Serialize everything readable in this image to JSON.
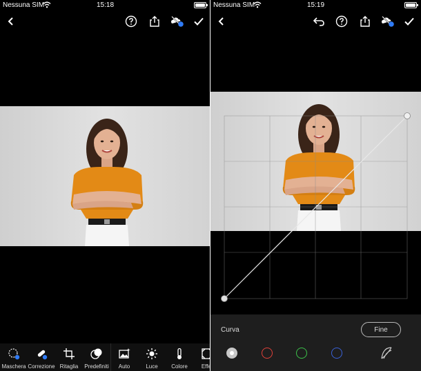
{
  "left_screen": {
    "status": {
      "carrier": "Nessuna SIM",
      "time": "15:18"
    },
    "toolbar": [
      {
        "id": "maschera",
        "label": "Maschera",
        "icon": "mask-icon"
      },
      {
        "id": "correzione",
        "label": "Correzione",
        "icon": "healing-brush-icon"
      },
      {
        "id": "ritaglia",
        "label": "Ritaglia",
        "icon": "crop-icon"
      },
      {
        "id": "predefiniti",
        "label": "Predefiniti",
        "icon": "presets-icon"
      },
      {
        "id": "auto",
        "label": "Auto",
        "icon": "auto-icon"
      },
      {
        "id": "luce",
        "label": "Luce",
        "icon": "sun-icon"
      },
      {
        "id": "colore",
        "label": "Colore",
        "icon": "thermometer-icon"
      },
      {
        "id": "effetti",
        "label": "Effet",
        "icon": "effects-icon"
      }
    ]
  },
  "right_screen": {
    "status": {
      "carrier": "Nessuna SIM",
      "time": "15:19"
    },
    "curve_panel": {
      "label": "Curva",
      "done_button": "Fine",
      "channels": [
        {
          "id": "rgb",
          "color": "#c8c8c8",
          "icon": "rgb-channel-icon"
        },
        {
          "id": "red",
          "color": "#e0403a",
          "icon": "red-channel-icon"
        },
        {
          "id": "green",
          "color": "#3cc24a",
          "icon": "green-channel-icon"
        },
        {
          "id": "blue",
          "color": "#3a62d8",
          "icon": "blue-channel-icon"
        }
      ]
    }
  },
  "colors": {
    "accent": "#2f7bf6",
    "background": "#000000",
    "panel": "#1e1e1e",
    "photo_bg": "#d9d9d9",
    "shirt": "#e38a16"
  }
}
